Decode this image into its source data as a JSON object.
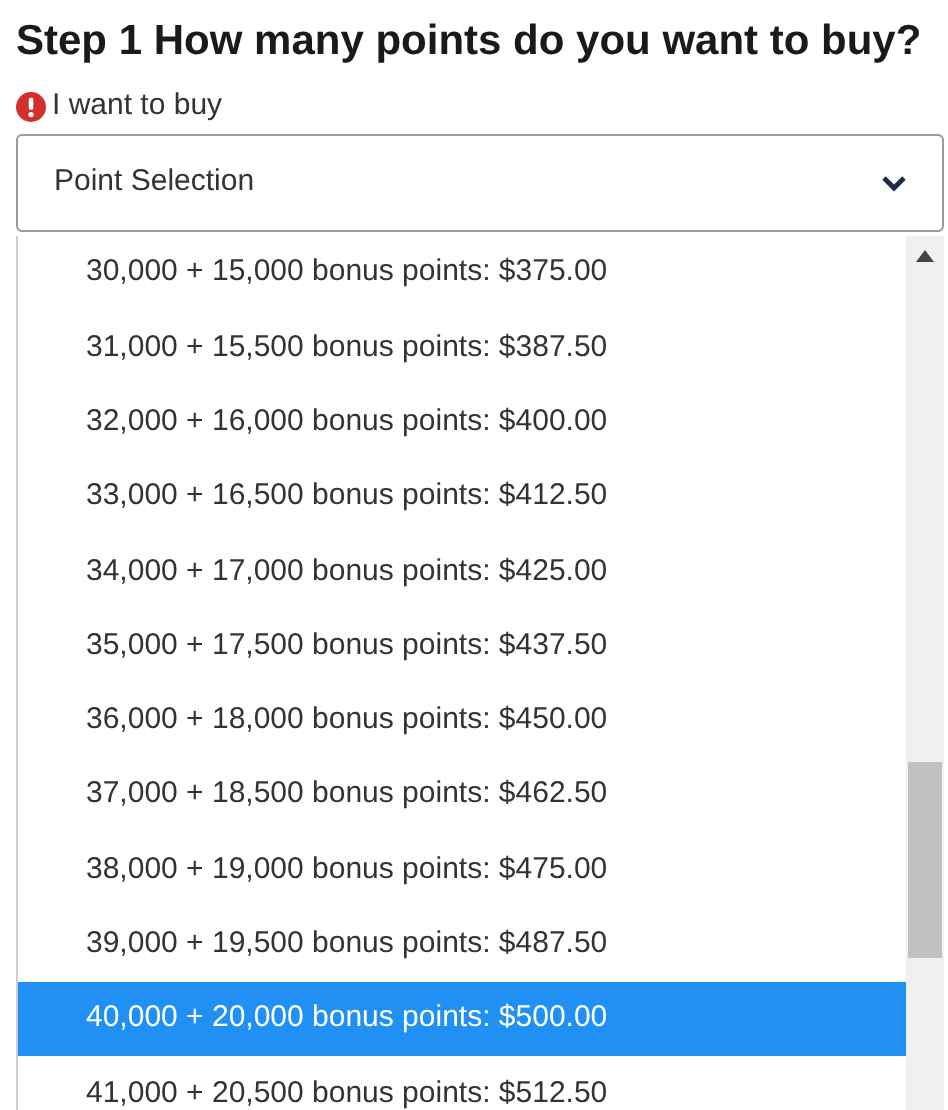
{
  "heading": "Step 1 How many points do you want to buy?",
  "field": {
    "label": "I want to buy",
    "required": true,
    "value": "Point Selection",
    "expanded": true
  },
  "options": [
    {
      "label": "30,000 + 15,000 bonus points: $375.00",
      "selected": false
    },
    {
      "label": "31,000 + 15,500 bonus points: $387.50",
      "selected": false
    },
    {
      "label": "32,000 + 16,000 bonus points: $400.00",
      "selected": false
    },
    {
      "label": "33,000 + 16,500 bonus points: $412.50",
      "selected": false
    },
    {
      "label": "34,000 + 17,000 bonus points: $425.00",
      "selected": false
    },
    {
      "label": "35,000 + 17,500 bonus points: $437.50",
      "selected": false
    },
    {
      "label": "36,000 + 18,000 bonus points: $450.00",
      "selected": false
    },
    {
      "label": "37,000 + 18,500 bonus points: $462.50",
      "selected": false
    },
    {
      "label": "38,000 + 19,000 bonus points: $475.00",
      "selected": false
    },
    {
      "label": "39,000 + 19,500 bonus points: $487.50",
      "selected": false
    },
    {
      "label": "40,000 + 20,000 bonus points: $500.00",
      "selected": true
    },
    {
      "label": "41,000 + 20,500 bonus points: $512.50",
      "selected": false
    }
  ]
}
